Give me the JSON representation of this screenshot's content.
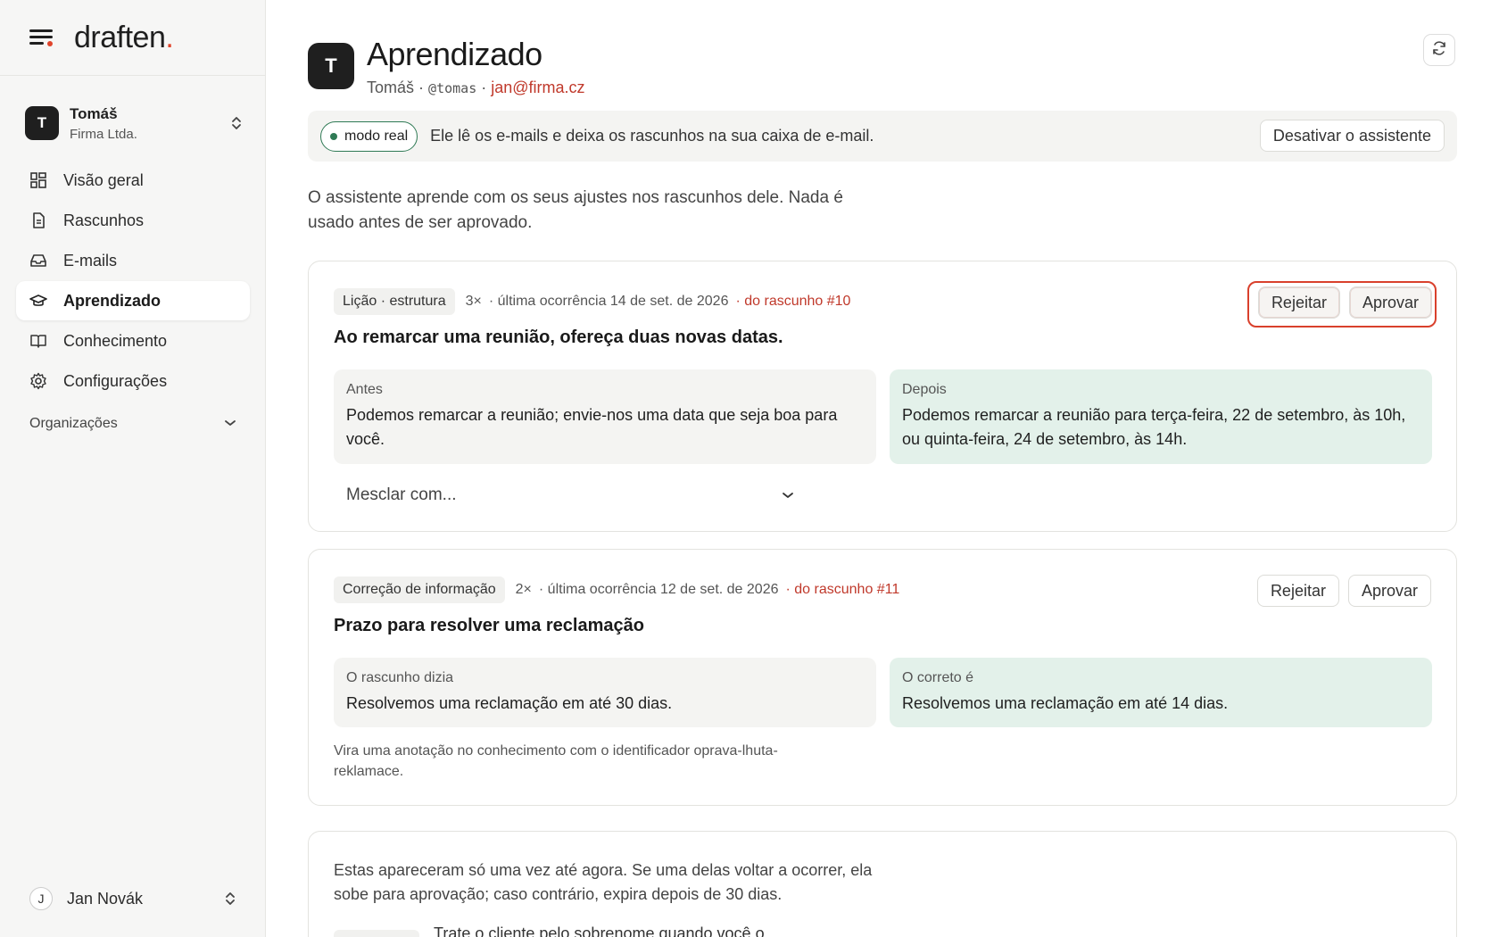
{
  "brand": {
    "name": "draften",
    "accent": "."
  },
  "workspace": {
    "initial": "T",
    "name": "Tomáš",
    "org": "Firma Ltda."
  },
  "nav": [
    {
      "label": "Visão geral",
      "icon": "grid-icon",
      "active": false
    },
    {
      "label": "Rascunhos",
      "icon": "document-icon",
      "active": false
    },
    {
      "label": "E-mails",
      "icon": "inbox-icon",
      "active": false
    },
    {
      "label": "Aprendizado",
      "icon": "graduation-cap-icon",
      "active": true
    },
    {
      "label": "Conhecimento",
      "icon": "book-icon",
      "active": false
    },
    {
      "label": "Configurações",
      "icon": "gear-icon",
      "active": false
    }
  ],
  "organizations_label": "Organizações",
  "user": {
    "initial": "J",
    "name": "Jan Novák"
  },
  "header": {
    "initial": "T",
    "title": "Aprendizado",
    "name": "Tomáš",
    "sep": "·",
    "handle": "@tomas",
    "email": "jan@firma.cz"
  },
  "banner": {
    "mode": "modo real",
    "text": "Ele lê os e-mails e deixa os rascunhos na sua caixa de e-mail.",
    "button": "Desativar o assistente"
  },
  "intro": "O assistente aprende com os seus ajustes nos rascunhos dele. Nada é usado antes de ser aprovado.",
  "lessons": [
    {
      "tag": "Lição · estrutura",
      "count": "3×",
      "last": "· última ocorrência 14 de set. de 2026",
      "source": "· do rascunho #10",
      "title": "Ao remarcar uma reunião, ofereça duas novas datas.",
      "before_label": "Antes",
      "before_text": "Podemos remarcar a reunião; envie-nos uma data que seja boa para você.",
      "after_label": "Depois",
      "after_text": "Podemos remarcar a reunião para terça-feira, 22 de setembro, às 10h, ou quinta-feira, 24 de setembro, às 14h.",
      "merge_placeholder": "Mesclar com...",
      "reject": "Rejeitar",
      "approve": "Aprovar"
    },
    {
      "tag": "Correção de informação",
      "count": "2×",
      "last": "· última ocorrência 12 de set. de 2026",
      "source": "· do rascunho #11",
      "title": "Prazo para resolver uma reclamação",
      "before_label": "O rascunho dizia",
      "before_text": "Resolvemos uma reclamação em até 30 dias.",
      "after_label": "O correto é",
      "after_text": "Resolvemos uma reclamação em até 14 dias.",
      "note": "Vira uma anotação no conhecimento com o identificador oprava-lhuta-reklamace.",
      "reject": "Rejeitar",
      "approve": "Aprovar"
    }
  ],
  "pending": {
    "text": "Estas apareceram só uma vez até agora. Se uma delas voltar a ocorrer, ela sobe para aprovação; caso contrário, expira depois de 30 dias.",
    "peek": "Trate o cliente pelo sobrenome quando você o..."
  },
  "colors": {
    "accent": "#e0442b",
    "live": "#2f7a55",
    "after_bg": "#e3f1ea",
    "link": "#c0392b"
  }
}
